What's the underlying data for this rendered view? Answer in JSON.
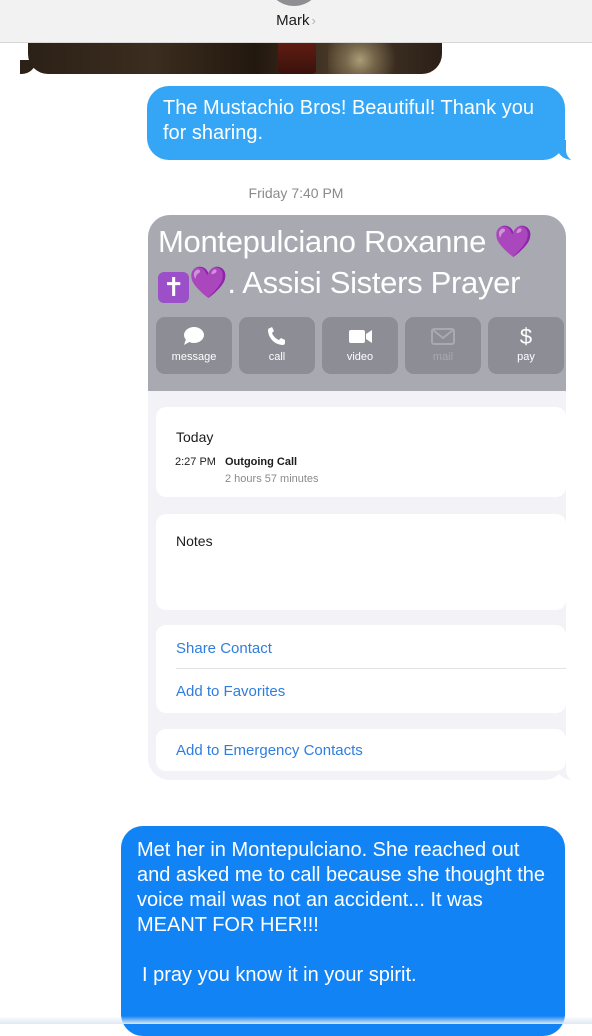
{
  "header": {
    "contact_name": "Mark",
    "chevron": "›"
  },
  "messages": {
    "sent_1": "The Mustachio Bros!  Beautiful! Thank you for sharing.",
    "timestamp_day": "Friday",
    "timestamp_time": "7:40 PM",
    "sent_2_line1": "Met her in Montepulciano.  She reached out and asked me to call because she thought the voice mail was not an accident... It was MEANT FOR HER!!!",
    "sent_2_line2": "I pray you know it in your spirit."
  },
  "contact_card": {
    "name_part1": "Montepulciano Roxanne ",
    "heart": "💜",
    "cross": "✝",
    "name_part2": ". Assisi Sisters Prayer",
    "actions": [
      {
        "label": "message",
        "icon": "message-bubble-icon"
      },
      {
        "label": "call",
        "icon": "phone-icon"
      },
      {
        "label": "video",
        "icon": "video-camera-icon"
      },
      {
        "label": "mail",
        "icon": "envelope-icon",
        "enabled": false
      },
      {
        "label": "pay",
        "icon": "dollar-icon"
      }
    ],
    "recent": {
      "day": "Today",
      "time": "2:27 PM",
      "type": "Outgoing Call",
      "duration": "2 hours 57 minutes"
    },
    "notes_label": "Notes",
    "links": [
      "Share Contact",
      "Add to Favorites",
      "Add to Emergency Contacts"
    ]
  },
  "colors": {
    "sent_bubble_light": "#34a6f5",
    "sent_bubble": "#1183f5",
    "card_header": "#a8a9b1",
    "link": "#2f7de0"
  }
}
